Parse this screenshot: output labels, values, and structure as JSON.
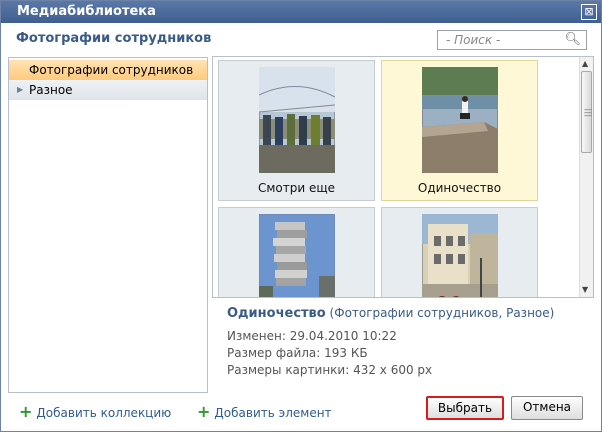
{
  "window": {
    "title": "Медиабиблиотека",
    "close_glyph": "⊠"
  },
  "library": {
    "heading": "Фотографии сотрудников"
  },
  "search": {
    "placeholder": "- Поиск -"
  },
  "tree": {
    "items": [
      {
        "label": "Фотографии сотрудников",
        "selected": true
      },
      {
        "label": "Разное",
        "selected": false
      }
    ]
  },
  "gallery": {
    "items": [
      {
        "caption": "Смотри еще",
        "selected": false
      },
      {
        "caption": "Одиночество",
        "selected": true
      },
      {
        "caption": "",
        "selected": false
      },
      {
        "caption": "",
        "selected": false
      }
    ]
  },
  "details": {
    "name": "Одиночество",
    "open_paren": "(",
    "category1": "Фотографии сотрудников",
    "comma": ",",
    "category2": "Разное",
    "close_paren": ")",
    "modified": "Изменен: 29.04.2010 10:22",
    "file_size": "Размер файла: 193 КБ",
    "dimensions": "Размеры картинки: 432 x 600 px"
  },
  "footer": {
    "add_collection": "Добавить коллекцию",
    "add_item": "Добавить элемент",
    "select_label": "Выбрать",
    "cancel_label": "Отмена"
  },
  "colors": {
    "accent": "#3a5b88",
    "selection": "#ffcb7c",
    "primary_border": "#d81b1b"
  }
}
